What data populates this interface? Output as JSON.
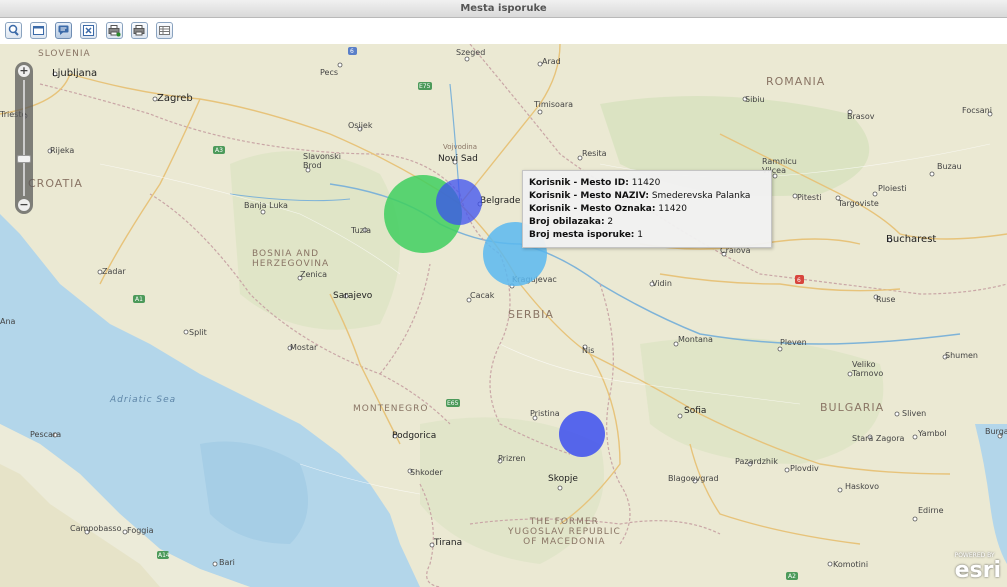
{
  "window": {
    "title": "Mesta isporuke"
  },
  "toolbar": {
    "buttons": [
      {
        "name": "zoom-tool-button",
        "icon": "magnifier-icon"
      },
      {
        "name": "window-button",
        "icon": "window-icon"
      },
      {
        "name": "popup-info-button",
        "icon": "speech-bubble-icon",
        "active": true
      },
      {
        "name": "excel-button",
        "icon": "excel-icon"
      },
      {
        "name": "print-add-button",
        "icon": "printer-plus-icon"
      },
      {
        "name": "print-button",
        "icon": "printer-icon"
      },
      {
        "name": "table-button",
        "icon": "table-icon"
      }
    ]
  },
  "map": {
    "countries": [
      "SLOVENIA",
      "CROATIA",
      "BOSNIA AND HERZEGOVINA",
      "SERBIA",
      "ROMANIA",
      "BULGARIA",
      "MONTENEGRO",
      "THE FORMER YUGOSLAV REPUBLIC OF MACEDONIA"
    ],
    "seas": [
      "Adriatic Sea"
    ],
    "cities": [
      "Ljubljana",
      "Zagreb",
      "Rijeka",
      "Pecs",
      "Szeged",
      "Arad",
      "Timisoara",
      "Sibiu",
      "Brasov",
      "Focsani",
      "Osijek",
      "Slavonski Brod",
      "Novi Sad",
      "Vojvodina",
      "Resita",
      "Rimnicu Vilcea",
      "Pitesti",
      "Ploiesti",
      "Targoviste",
      "Buzau",
      "Banja Luka",
      "Tuzla",
      "Belgrade",
      "Craiova",
      "Bucharest",
      "Zadar",
      "Zenica",
      "Sarajevo",
      "Cacak",
      "Kragujevac",
      "Vidin",
      "Ruse",
      "Split",
      "Mostar",
      "Nis",
      "Montana",
      "Pleven",
      "Shumen",
      "Veliko Tarnovo",
      "Pristina",
      "Sofia",
      "Sliven",
      "Stara Zagora",
      "Yambol",
      "Burgas",
      "Podgorica",
      "Pescara",
      "Prizren",
      "Pazardzhik",
      "Plovdiv",
      "Shkoder",
      "Skopje",
      "Blagoevgrad",
      "Haskovo",
      "Edirne",
      "Campobasso",
      "Foggia",
      "Tirana",
      "Bari",
      "Komotini",
      "Trieste",
      "Ana"
    ],
    "road_shields": [
      "6",
      "E75",
      "A3",
      "A1",
      "E65",
      "A14",
      "A2",
      "6"
    ],
    "zoom": {
      "plus": "+",
      "minus": "−"
    },
    "attribution": {
      "powered": "POWERED BY",
      "brand": "esri"
    },
    "bubbles": [
      {
        "name": "bubble-tuzla-area",
        "color": "#3fcf5f"
      },
      {
        "name": "bubble-belgrade",
        "color": "#3c4ff0"
      },
      {
        "name": "bubble-smederevska-palanka",
        "color": "#5ab8f0"
      },
      {
        "name": "bubble-pristina",
        "color": "#3c4ff0"
      }
    ]
  },
  "popup": {
    "rows": [
      {
        "label": "Korisnik - Mesto ID:",
        "value": "11420"
      },
      {
        "label": "Korisnik - Mesto NAZIV:",
        "value": "Smederevska Palanka"
      },
      {
        "label": "Korisnik - Mesto Oznaka:",
        "value": "11420"
      },
      {
        "label": "Broj obilazaka:",
        "value": "2"
      },
      {
        "label": "Broj mesta isporuke:",
        "value": "1"
      }
    ]
  }
}
